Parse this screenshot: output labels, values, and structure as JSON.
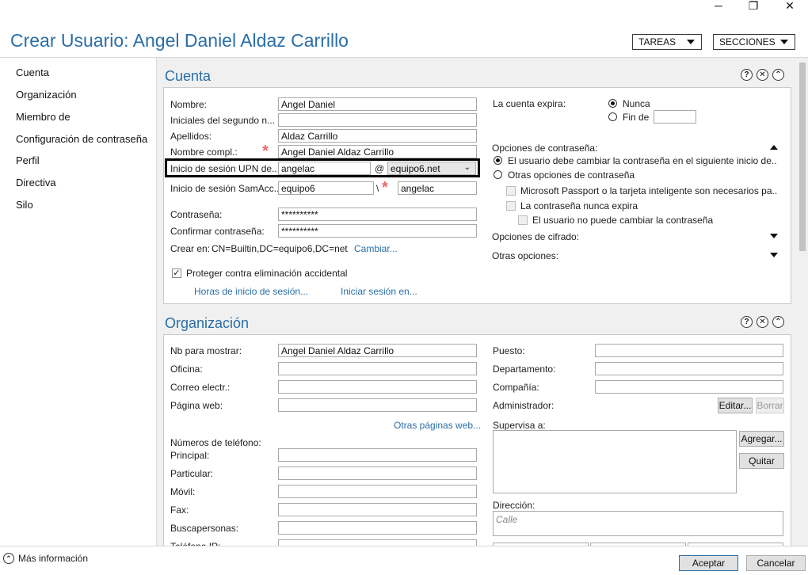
{
  "window": {
    "minimize": "─",
    "restore": "❐",
    "close": "✕"
  },
  "header": {
    "title": "Crear Usuario: Angel Daniel Aldaz Carrillo",
    "tasks_button": "TAREAS",
    "sections_button": "SECCIONES"
  },
  "sidebar": {
    "items": [
      {
        "label": "Cuenta"
      },
      {
        "label": "Organización"
      },
      {
        "label": "Miembro de"
      },
      {
        "label": "Configuración de contraseña"
      },
      {
        "label": "Perfil"
      },
      {
        "label": "Directiva"
      },
      {
        "label": "Silo"
      }
    ]
  },
  "account": {
    "title": "Cuenta",
    "help": "?",
    "close": "✕",
    "collapse": "⌃",
    "first_name_label": "Nombre:",
    "first_name": "Angel Daniel",
    "initials_label": "Iniciales del segundo n...",
    "initials": "",
    "last_name_label": "Apellidos:",
    "last_name": "Aldaz Carrillo",
    "full_name_label": "Nombre compl.:",
    "full_name": "Angel Daniel Aldaz Carrillo",
    "upn_label": "Inicio de sesión UPN de...",
    "upn_user": "angelac",
    "at": "@",
    "upn_domain": "equipo6.net",
    "sam_label": "Inicio de sesión SamAcc...",
    "sam_domain": "equipo6",
    "sam_sep": "\\",
    "sam_user": "angelac",
    "password_label": "Contraseña:",
    "password": "**********",
    "confirm_label": "Confirmar contraseña:",
    "confirm": "**********",
    "create_in_label": "Crear en:",
    "create_in": "CN=Builtin,DC=equipo6,DC=net",
    "change_link": "Cambiar...",
    "protect_label": "Proteger contra eliminación accidental",
    "logon_hours_link": "Horas de inicio de sesión...",
    "logon_to_link": "Iniciar sesión en...",
    "expires_label": "La cuenta expira:",
    "never": "Nunca",
    "end_of": "Fin de",
    "end_of_value": "",
    "pw_options_label": "Opciones de contraseña:",
    "pw_opt_must_change": "El usuario debe cambiar la contraseña en el siguiente inicio de...",
    "pw_opt_other": "Otras opciones de contraseña",
    "pw_opt_passport": "Microsoft Passport o la tarjeta inteligente son necesarios pa...",
    "pw_opt_never_expires": "La contraseña nunca expira",
    "pw_opt_cannot_change": "El usuario no puede cambiar la contraseña",
    "encryption_label": "Opciones de cifrado:",
    "other_options_label": "Otras opciones:"
  },
  "organization": {
    "title": "Organización",
    "help": "?",
    "close": "✕",
    "collapse": "⌃",
    "display_name_label": "Nb para mostrar:",
    "display_name": "Angel Daniel Aldaz Carrillo",
    "office_label": "Oficina:",
    "email_label": "Correo electr.:",
    "web_label": "Página web:",
    "other_web_link": "Otras páginas web...",
    "phones_label": "Números de teléfono:",
    "main_label": "Principal:",
    "home_label": "Particular:",
    "mobile_label": "Móvil:",
    "fax_label": "Fax:",
    "pager_label": "Buscapersonas:",
    "ip_label": "Teléfono IP:",
    "job_label": "Puesto:",
    "dept_label": "Departamento:",
    "company_label": "Compañía:",
    "manager_label": "Administrador:",
    "edit_btn": "Editar...",
    "clear_btn": "Borrar",
    "supervises_label": "Supervisa a:",
    "add_btn": "Agregar...",
    "remove_btn": "Quitar",
    "address_label": "Dirección:",
    "street_placeholder": "Calle"
  },
  "footer": {
    "more_info": "Más información",
    "ok": "Aceptar",
    "cancel": "Cancelar"
  }
}
